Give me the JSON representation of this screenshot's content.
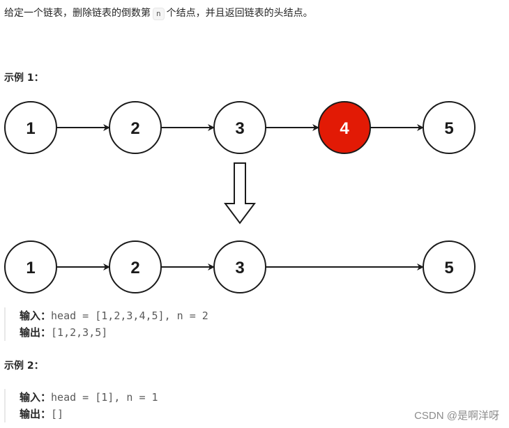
{
  "intro": {
    "before": "给定一个链表，删除链表的倒数第",
    "code": "n",
    "after": "个结点，并且返回链表的头结点。"
  },
  "example1": {
    "title": "示例 1：",
    "before_list": [
      "1",
      "2",
      "3",
      "4",
      "5"
    ],
    "removed_index": 3,
    "after_list": [
      "1",
      "2",
      "3",
      "5"
    ],
    "input_label": "输入：",
    "input_value": "head = [1,2,3,4,5], n = 2",
    "output_label": "输出：",
    "output_value": "[1,2,3,5]"
  },
  "example2": {
    "title": "示例 2：",
    "input_label": "输入：",
    "input_value": "head = [1], n = 1",
    "output_label": "输出：",
    "output_value": "[]"
  },
  "colors": {
    "removed_node": "#e21a05",
    "stroke": "#1a1a1a"
  },
  "watermark": "CSDN @是啊洋呀"
}
